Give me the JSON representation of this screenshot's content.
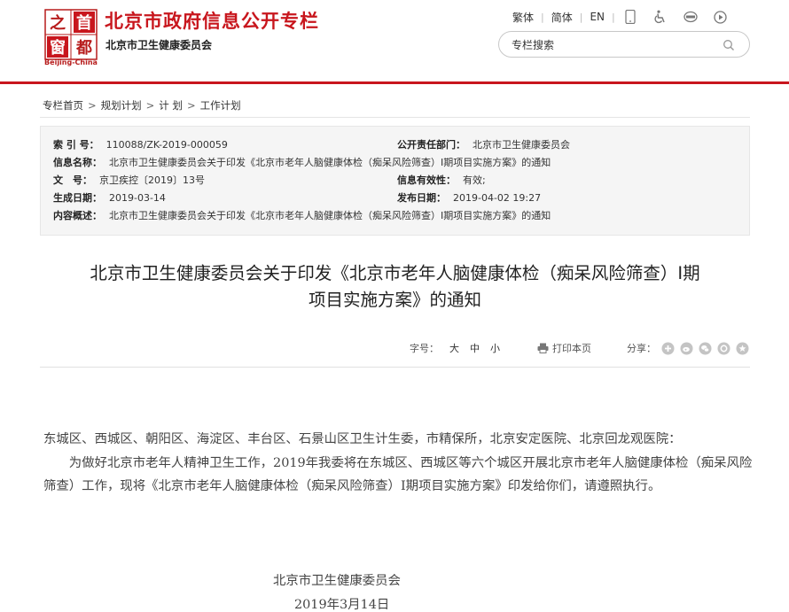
{
  "header": {
    "logo_text": [
      "首",
      "都",
      "之",
      "窗"
    ],
    "logo_caption": "Beijing-China",
    "site_title": "北京市政府信息公开专栏",
    "site_subtitle": "北京市卫生健康委员会",
    "links": {
      "traditional": "繁体",
      "simplified": "简体",
      "english": "EN"
    },
    "icons": [
      "mobile-icon",
      "accessibility-icon",
      "elder-mode-icon",
      "audio-play-icon"
    ],
    "search": {
      "placeholder": "专栏搜索"
    }
  },
  "colors": {
    "brand_red": "#c8161d",
    "meta_bg": "#f5f5f5"
  },
  "breadcrumb": [
    "专栏首页",
    "规划计划",
    "计 划",
    "工作计划"
  ],
  "meta": {
    "index_label": "索 引 号：",
    "index_value": "110088/ZK-2019-000059",
    "dept_label": "公开责任部门：",
    "dept_value": "北京市卫生健康委员会",
    "name_label": "信息名称：",
    "name_value": "北京市卫生健康委员会关于印发《北京市老年人脑健康体检（痴呆风险筛查）Ⅰ期项目实施方案》的通知",
    "docno_label": "文　号：",
    "docno_value": "京卫疾控〔2019〕13号",
    "validity_label": "信息有效性：",
    "validity_value": "有效;",
    "gen_label": "生成日期：",
    "gen_value": "2019-03-14",
    "pub_label": "发布日期：",
    "pub_value": "2019-04-02 19:27",
    "summary_label": "内容概述：",
    "summary_value": "北京市卫生健康委员会关于印发《北京市老年人脑健康体检（痴呆风险筛查）Ⅰ期项目实施方案》的通知"
  },
  "article": {
    "title_line1": "北京市卫生健康委员会关于印发《北京市老年人脑健康体检（痴呆风险筛查）Ⅰ期",
    "title_line2": "项目实施方案》的通知",
    "tools": {
      "font_label": "字号：",
      "large": "大",
      "medium": "中",
      "small": "小",
      "print": "打印本页",
      "share": "分享："
    },
    "share_icons": [
      "share-qzone-icon",
      "share-weibo-icon",
      "share-wechat-icon",
      "share-renren-icon",
      "share-more-icon"
    ],
    "recipients": "东城区、西城区、朝阳区、海淀区、丰台区、石景山区卫生计生委，市精保所，北京安定医院、北京回龙观医院：",
    "paragraph": "为做好北京市老年人精神卫生工作，2019年我委将在东城区、西城区等六个城区开展北京市老年人脑健康体检（痴呆风险筛查）工作，现将《北京市老年人脑健康体检（痴呆风险筛查）Ⅰ期项目实施方案》印发给你们，请遵照执行。",
    "signer": "北京市卫生健康委员会",
    "date": "2019年3月14日"
  }
}
